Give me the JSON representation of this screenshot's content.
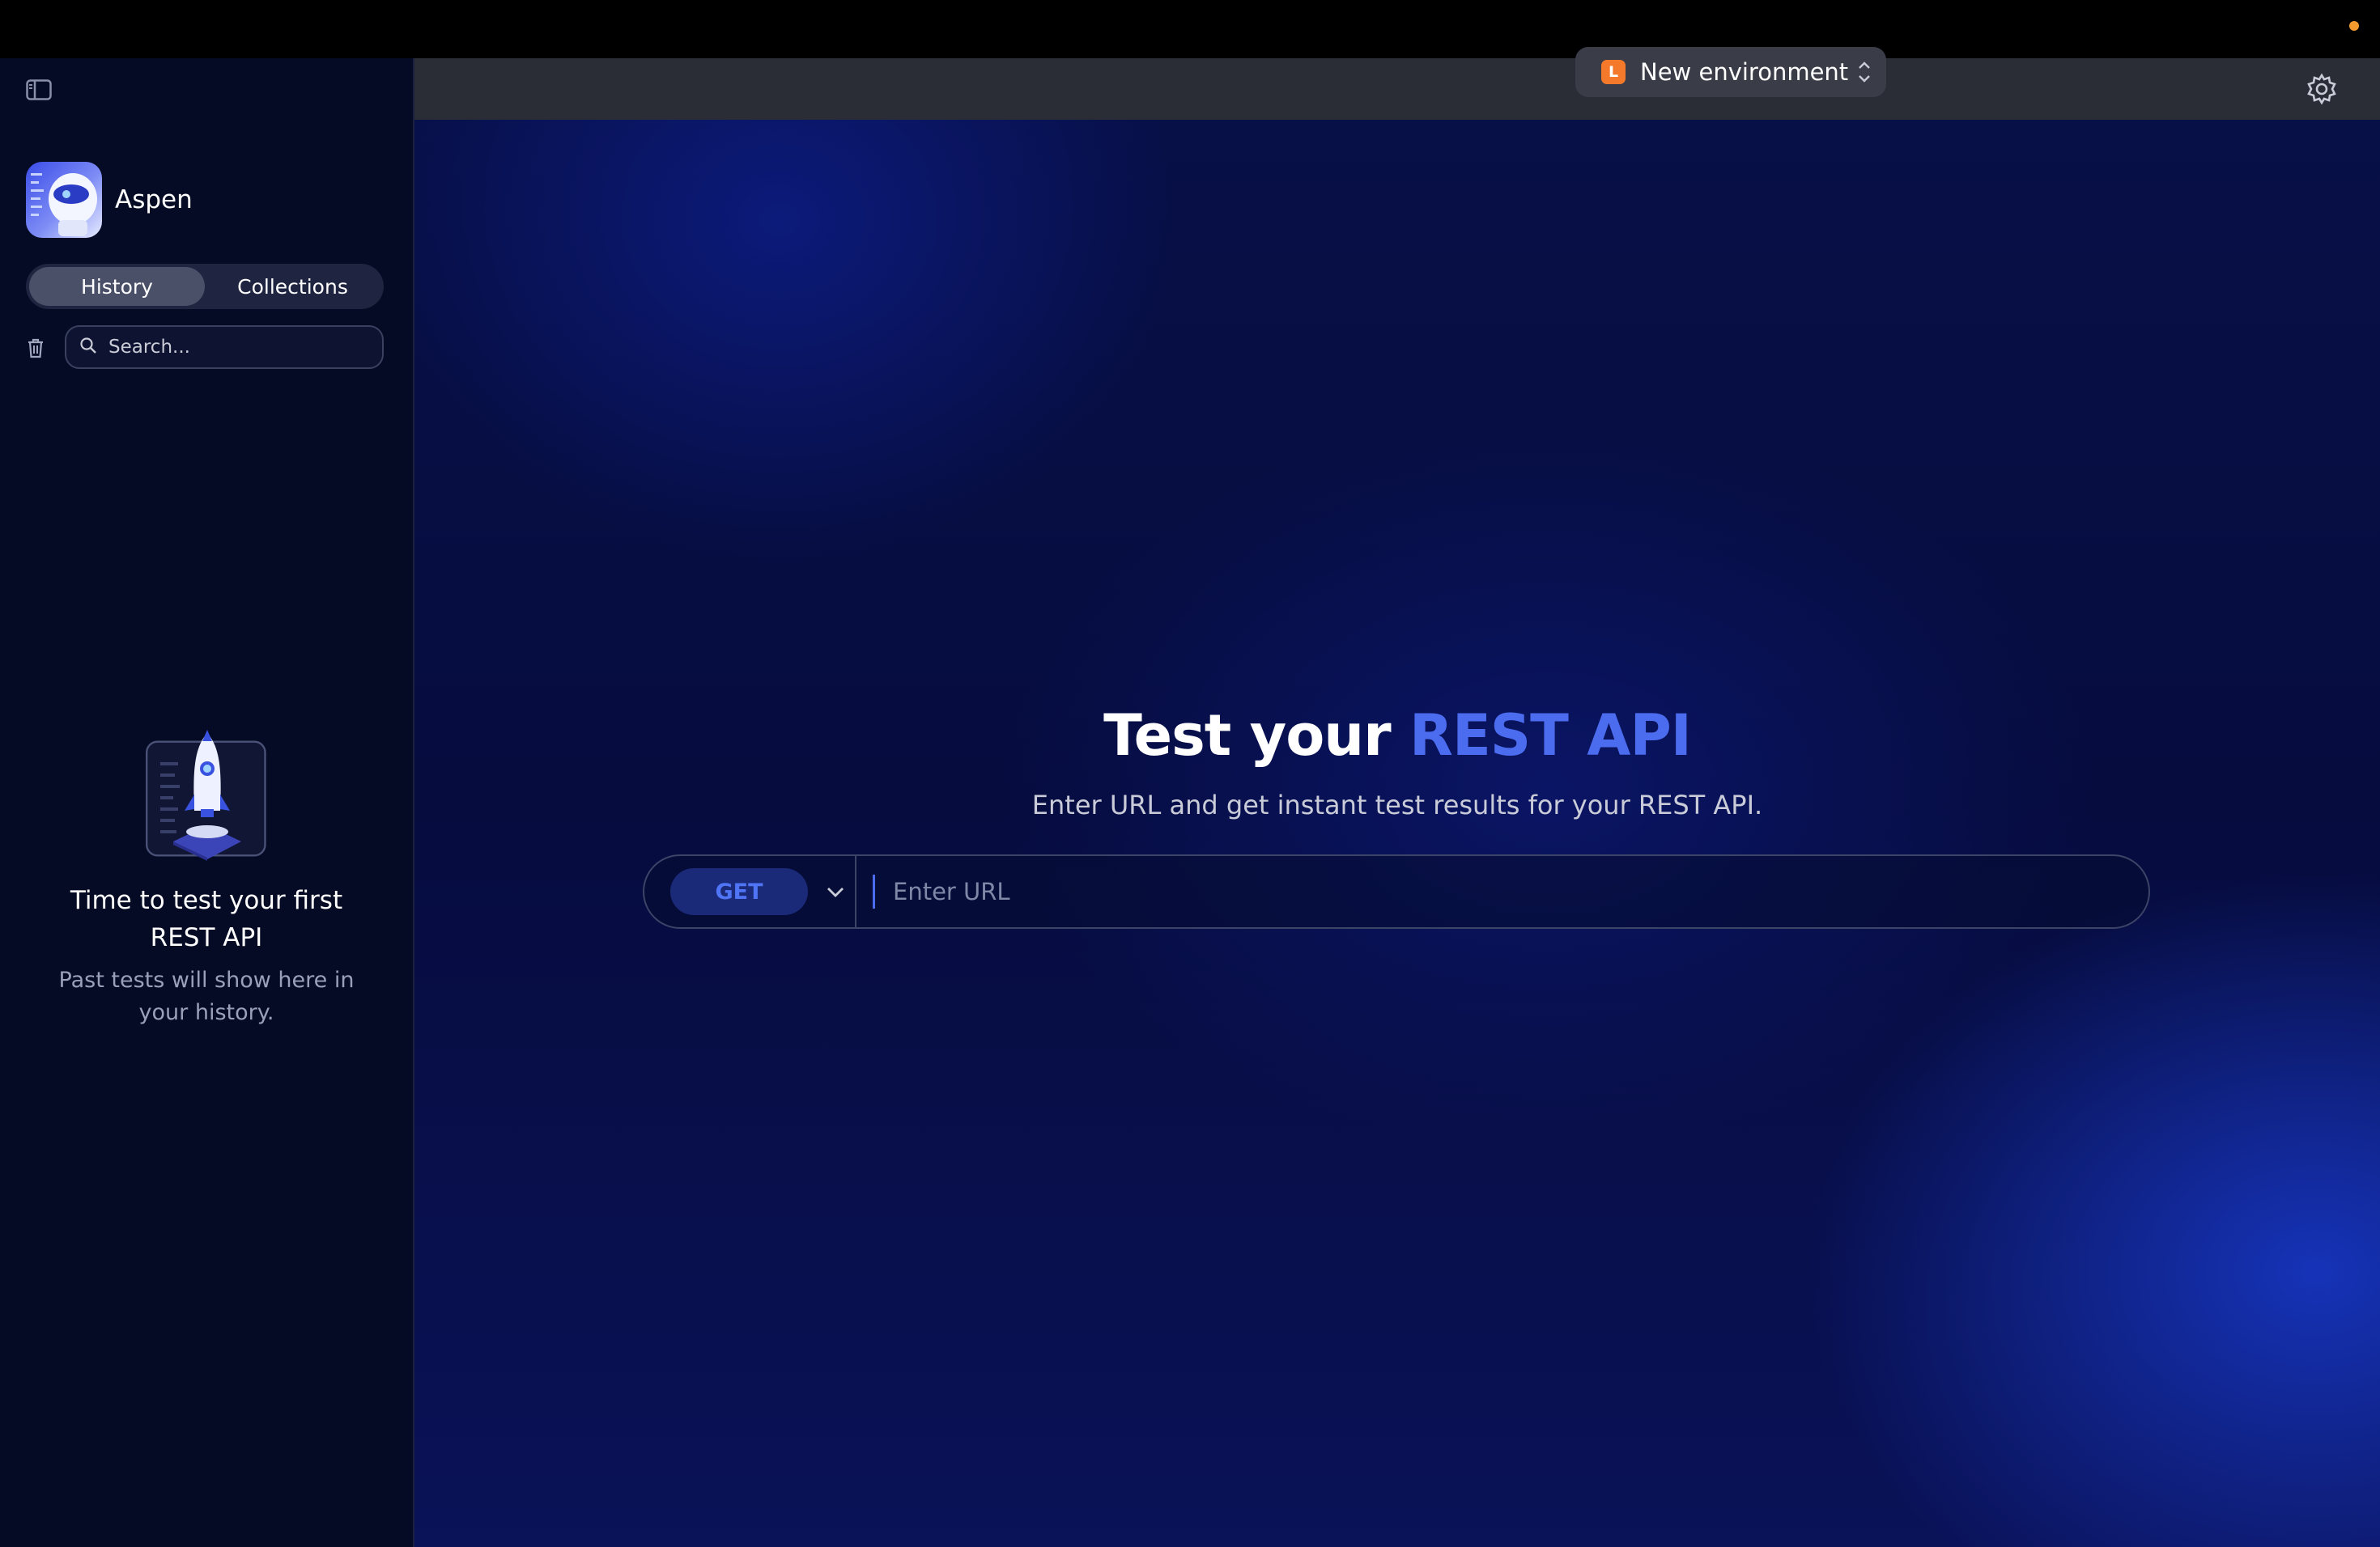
{
  "sidebar": {
    "app_name": "Aspen",
    "tabs": [
      {
        "label": "History",
        "active": true
      },
      {
        "label": "Collections",
        "active": false
      }
    ],
    "search": {
      "placeholder": "Search..."
    },
    "empty_state": {
      "title": "Time to test your first REST API",
      "subtitle": "Past tests will show here in your history."
    }
  },
  "header": {
    "environment": {
      "badge": "L",
      "label": "New environment"
    }
  },
  "main": {
    "hero_title_plain": "Test your",
    "hero_title_accent": "REST API",
    "hero_subtitle": "Enter URL and get instant test results for your REST API.",
    "method": "GET",
    "url_placeholder": "Enter URL"
  },
  "colors": {
    "accent": "#4c6cf0",
    "env_badge": "#f4792a",
    "status_dot": "#f39a2e",
    "sidebar_bg": "#050b24"
  },
  "icons": [
    "sidebar-toggle-icon",
    "trash-icon",
    "search-icon",
    "chevron-updown-icon",
    "gear-icon",
    "chevron-down-icon",
    "rocket-illustration"
  ]
}
